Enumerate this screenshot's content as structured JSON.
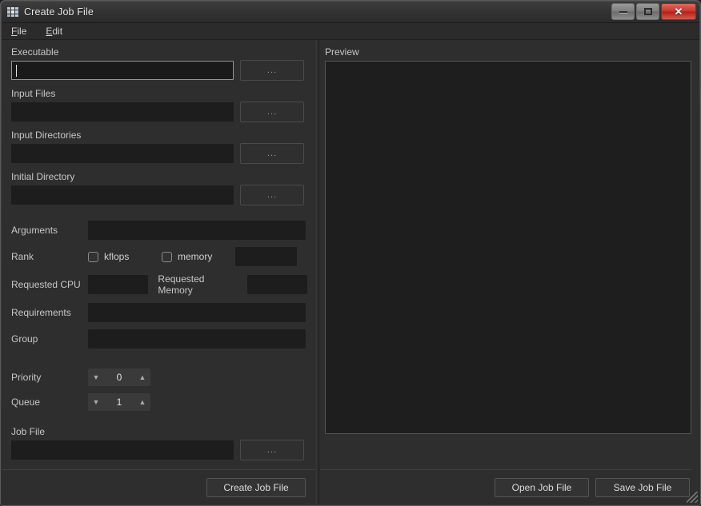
{
  "window": {
    "title": "Create Job File",
    "icon": "app-grid-icon",
    "controls": {
      "minimize": "minimize-icon",
      "maximize": "maximize-icon",
      "close": "✕"
    }
  },
  "menubar": {
    "items": [
      {
        "label": "File",
        "accel": "F"
      },
      {
        "label": "Edit",
        "accel": "E"
      }
    ]
  },
  "form": {
    "executable": {
      "label": "Executable",
      "value": "",
      "focused": true,
      "browse_label": "..."
    },
    "input_files": {
      "label": "Input Files",
      "value": "",
      "browse_label": "..."
    },
    "input_directories": {
      "label": "Input Directories",
      "value": "",
      "browse_label": "..."
    },
    "initial_directory": {
      "label": "Initial Directory",
      "value": "",
      "browse_label": "..."
    },
    "arguments": {
      "label": "Arguments",
      "value": ""
    },
    "rank": {
      "label": "Rank",
      "kflops_label": "kflops",
      "kflops_checked": false,
      "memory_label": "memory",
      "memory_checked": false,
      "value": ""
    },
    "requested_cpu": {
      "label": "Requested CPU",
      "value": ""
    },
    "requested_memory": {
      "label": "Requested Memory",
      "value": ""
    },
    "requirements": {
      "label": "Requirements",
      "value": ""
    },
    "group": {
      "label": "Group",
      "value": ""
    },
    "priority": {
      "label": "Priority",
      "value": "0",
      "down_icon": "▼",
      "up_icon": "▲"
    },
    "queue": {
      "label": "Queue",
      "value": "1",
      "down_icon": "▼",
      "up_icon": "▲"
    },
    "job_file": {
      "label": "Job File",
      "value": "",
      "browse_label": "..."
    }
  },
  "actions": {
    "create_job_file": "Create Job File",
    "open_job_file": "Open Job File",
    "save_job_file": "Save Job File"
  },
  "preview": {
    "label": "Preview",
    "content": ""
  },
  "colors": {
    "window_bg": "#2e2e2e",
    "field_bg": "#1d1d1d",
    "focus_border": "#8899a6",
    "text": "#c6c6c6",
    "close_red": "#c9342a"
  }
}
